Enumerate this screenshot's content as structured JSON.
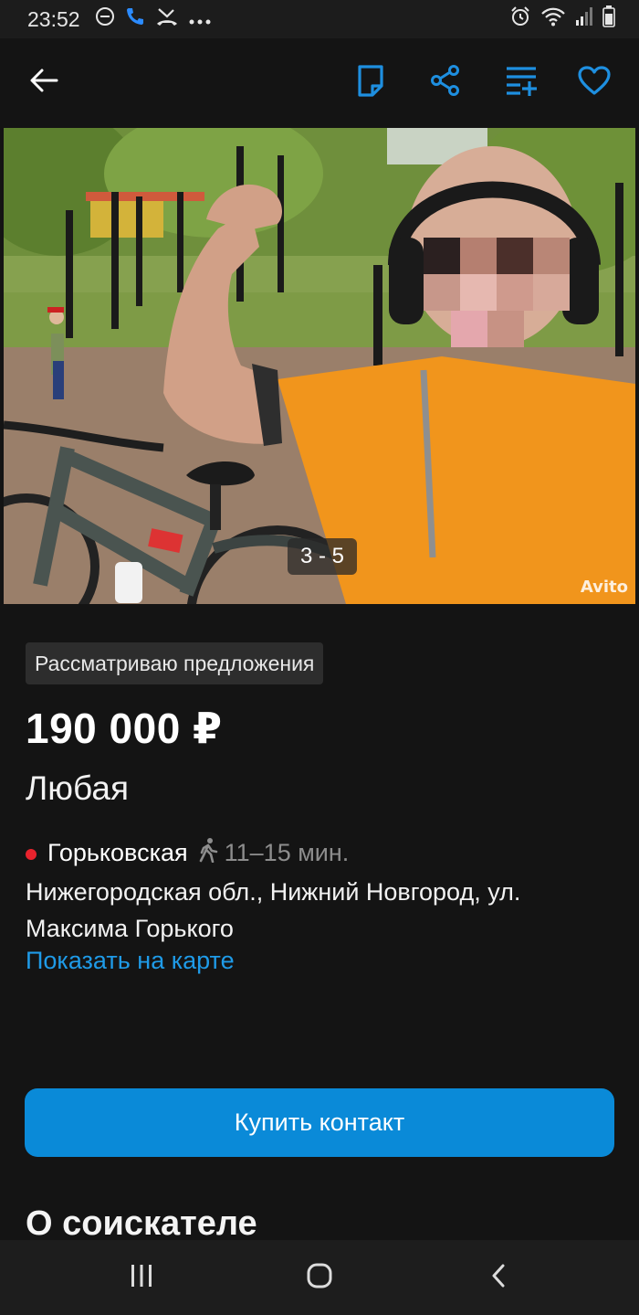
{
  "status_bar": {
    "time": "23:52",
    "left_icons": [
      "dnd-icon",
      "call-icon",
      "missed-call-icon",
      "more-dots-icon"
    ],
    "right_icons": [
      "alarm-icon",
      "wifi-icon",
      "signal-icon",
      "battery-icon"
    ]
  },
  "app_bar": {
    "back_icon": "arrow-left-icon",
    "actions": [
      "note-icon",
      "share-icon",
      "compare-icon",
      "favorite-heart-icon"
    ],
    "accent_color": "#1e8fe0"
  },
  "gallery": {
    "counter": "3 - 5",
    "watermark": "Avito"
  },
  "listing": {
    "badge": "Рассматриваю предложения",
    "price": "190 000 ₽",
    "subtitle": "Любая",
    "metro_station": "Горьковская",
    "metro_color": "#e8232d",
    "walk_time": "11–15 мин.",
    "address": "Нижегородская обл., Нижний Новгород, ул. Максима Горького",
    "map_link": "Показать на карте"
  },
  "actions": {
    "buy_contact": "Купить контакт",
    "button_color": "#0a8ad8"
  },
  "sections": {
    "about": "О соискателе"
  },
  "nav_bar": {
    "buttons": [
      "recent-apps-icon",
      "home-icon",
      "back-icon"
    ]
  }
}
